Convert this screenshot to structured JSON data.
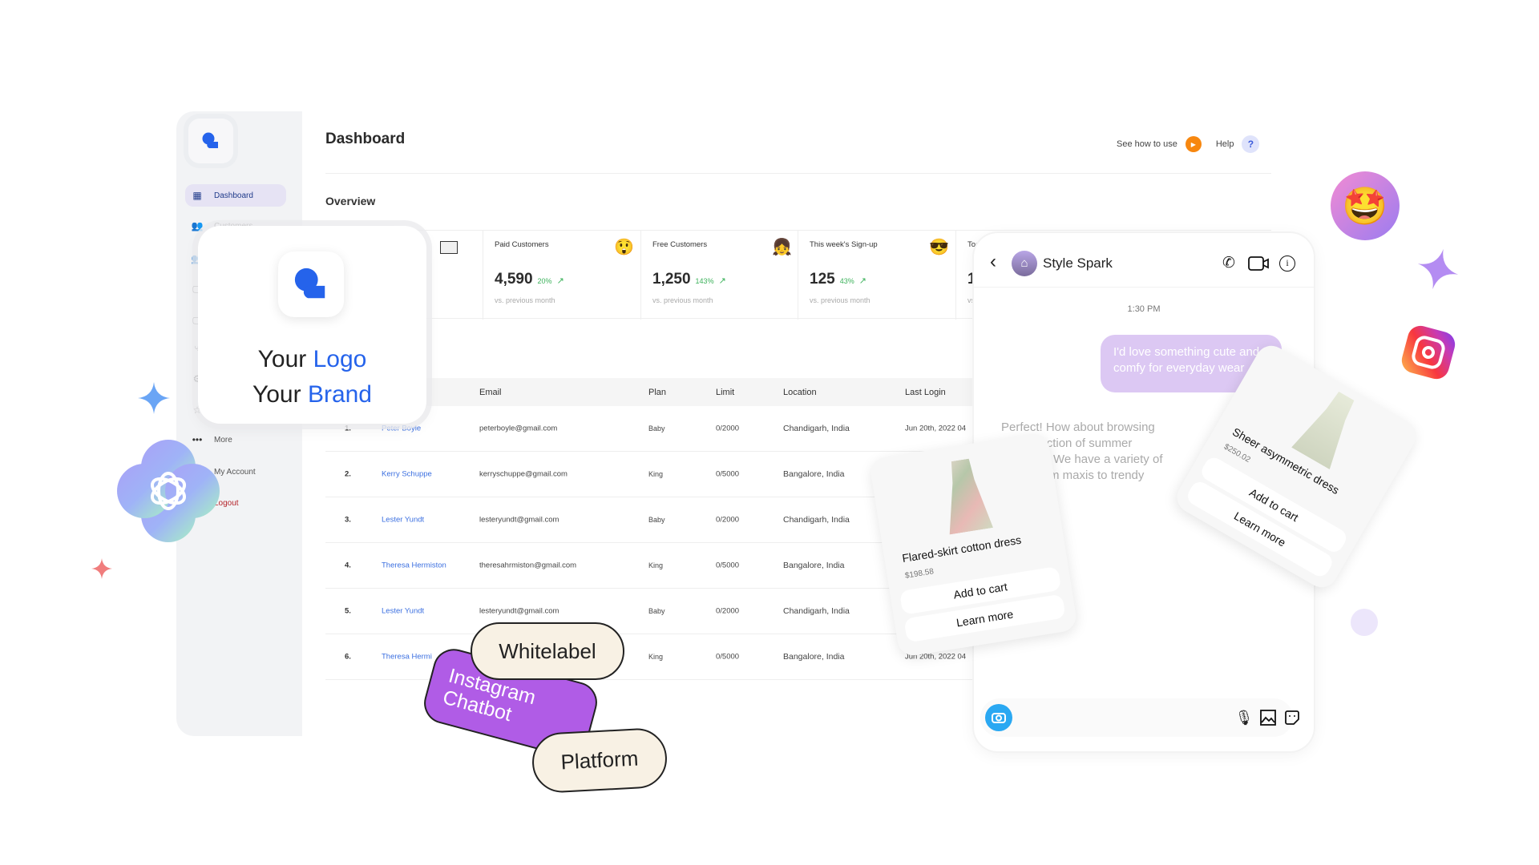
{
  "sidebar": {
    "items": [
      {
        "label": "Dashboard",
        "icon": "dashboard-icon",
        "active": true
      },
      {
        "label": "Customers",
        "icon": "customers-icon"
      },
      {
        "label": "",
        "icon": "team-icon"
      },
      {
        "label": "",
        "icon": "monitor-icon"
      },
      {
        "label": "",
        "icon": "monitor-icon"
      },
      {
        "label": "",
        "icon": "flow-icon"
      },
      {
        "label": "",
        "icon": "gear-icon"
      },
      {
        "label": "",
        "icon": "star-icon"
      },
      {
        "label": "More",
        "icon": "more-icon"
      },
      {
        "label": "My Account",
        "icon": ""
      },
      {
        "label": "Logout",
        "icon": "",
        "color": "#b4232a"
      }
    ]
  },
  "header": {
    "title": "Dashboard",
    "see_how": "See how to use",
    "help": "Help",
    "help_icon": "?"
  },
  "overview": {
    "title": "Overview",
    "cards": [
      {
        "label": "Paid Customers",
        "value": "4,590",
        "change": "20%",
        "sub": "vs. previous month",
        "emoji": "😲"
      },
      {
        "label": "Free Customers",
        "value": "1,250",
        "change": "143%",
        "sub": "vs. previous month",
        "emoji": "👧"
      },
      {
        "label": "This week's Sign-up",
        "value": "125",
        "change": "43%",
        "sub": "vs. previous month",
        "emoji": "😎"
      },
      {
        "label": "Tod",
        "value": "1",
        "change": "",
        "sub": "vs",
        "emoji": ""
      }
    ]
  },
  "table": {
    "headers": [
      "Email",
      "Plan",
      "Limit",
      "Location",
      "Last Login"
    ],
    "rows": [
      {
        "n": "1.",
        "name": "Peter Boyle",
        "email": "peterboyle@gmail.com",
        "plan": "Baby",
        "limit": "0/2000",
        "location": "Chandigarh, India",
        "last": "Jun 20th, 2022 04"
      },
      {
        "n": "2.",
        "name": "Kerry Schuppe",
        "email": "kerryschuppe@gmail.com",
        "plan": "King",
        "limit": "0/5000",
        "location": "Bangalore, India",
        "last": ""
      },
      {
        "n": "3.",
        "name": "Lester Yundt",
        "email": "lesteryundt@gmail.com",
        "plan": "Baby",
        "limit": "0/2000",
        "location": "Chandigarh, India",
        "last": ""
      },
      {
        "n": "4.",
        "name": "Theresa Hermiston",
        "email": "theresahrmiston@gmail.com",
        "plan": "King",
        "limit": "0/5000",
        "location": "Bangalore, India",
        "last": ""
      },
      {
        "n": "5.",
        "name": "Lester Yundt",
        "email": "lesteryundt@gmail.com",
        "plan": "Baby",
        "limit": "0/2000",
        "location": "Chandigarh, India",
        "last": ""
      },
      {
        "n": "6.",
        "name": "Theresa Hermi",
        "email": "",
        "plan": "King",
        "limit": "0/5000",
        "location": "Bangalore, India",
        "last": "Jun 20th, 2022 04"
      }
    ]
  },
  "brand_card": {
    "line1_a": "Your ",
    "line1_b": "Logo",
    "line2_a": "Your ",
    "line2_b": "Brand"
  },
  "chat": {
    "name": "Style Spark",
    "time": "1:30 PM",
    "user_message": "I'd love something cute and comfy for everyday wear",
    "bot_message": "Perfect! How about browsing our collection of summer dresses? We have a variety of styles from maxis to trendy minis.",
    "products": [
      {
        "title": "Flared-skirt cotton dress",
        "price": "$198.58",
        "add": "Add to cart",
        "learn": "Learn more"
      },
      {
        "title": "Sheer asymmetric dress",
        "price": "$250.02",
        "add": "Add to cart",
        "learn": "Learn more"
      }
    ]
  },
  "stickers": {
    "whitelabel": "Whitelabel",
    "instagram": "Instagram Chatbot",
    "platform": "Platform"
  },
  "colors": {
    "brand_blue": "#2563eb",
    "accent_purple": "#b05ce6",
    "sticker_cream": "#f8f1e4",
    "orange": "#f7870f"
  }
}
